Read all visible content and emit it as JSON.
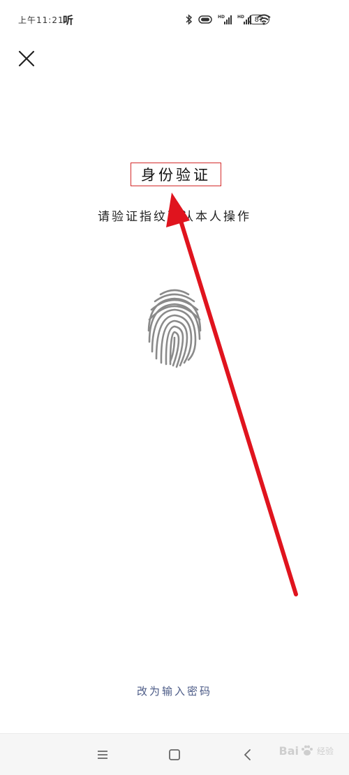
{
  "status_bar": {
    "time": "上午11:21",
    "app_glyph": "听",
    "battery_level": "87",
    "icons": [
      "bluetooth-icon",
      "vibrate-icon",
      "hd-signal-icon",
      "hd-signal-icon",
      "wifi-icon",
      "battery-icon"
    ]
  },
  "close_button": {
    "icon": "close-icon"
  },
  "auth": {
    "title": "身份验证",
    "subtitle": "请验证指纹确认本人操作",
    "fingerprint_icon": "fingerprint-icon"
  },
  "footer": {
    "switch_label": "改为输入密码"
  },
  "nav_bar": {
    "buttons": [
      "menu-icon",
      "home-icon",
      "back-icon"
    ]
  },
  "watermark": {
    "text": "Bai",
    "suffix": "经验"
  },
  "colors": {
    "highlight_box": "#d42a2a",
    "arrow": "#e0141e",
    "link": "#4b5a86",
    "fingerprint": "#8a8a8a"
  }
}
